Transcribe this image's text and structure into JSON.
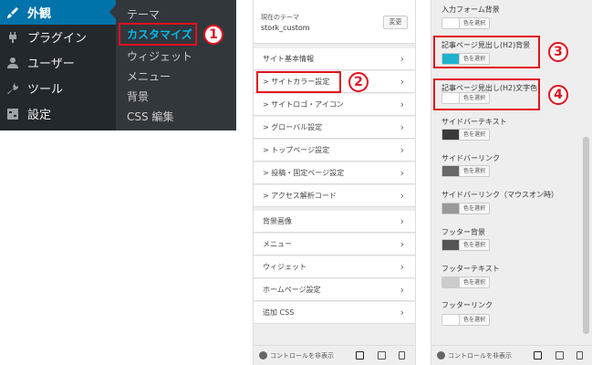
{
  "wp_menu": {
    "items": [
      {
        "label": "外観",
        "icon": "paintbrush-icon",
        "active": true
      },
      {
        "label": "プラグイン",
        "icon": "plug-icon",
        "active": false
      },
      {
        "label": "ユーザー",
        "icon": "user-icon",
        "active": false
      },
      {
        "label": "ツール",
        "icon": "wrench-icon",
        "active": false
      },
      {
        "label": "設定",
        "icon": "settings-icon",
        "active": false
      }
    ],
    "submenu": [
      "テーマ",
      "カスタマイズ",
      "ウィジェット",
      "メニュー",
      "背景",
      "CSS 編集"
    ]
  },
  "annotations": [
    "1",
    "2",
    "3",
    "4"
  ],
  "customizer": {
    "current_theme_label": "現在のテーマ",
    "theme_name": "stork_custom",
    "change_button": "変更",
    "sections": [
      {
        "label": "サイト基本情報"
      },
      {
        "label": "> サイトカラー設定"
      },
      {
        "label": "> サイトロゴ・アイコン"
      },
      {
        "label": "> グローバル設定"
      },
      {
        "label": "> トップページ設定"
      },
      {
        "label": "> 投稿・固定ページ設定"
      },
      {
        "label": "> アクセス解析コード"
      },
      {
        "label": "背景画像"
      },
      {
        "label": "メニュー"
      },
      {
        "label": "ウィジェット"
      },
      {
        "label": "ホームページ設定"
      },
      {
        "label": "追加 CSS"
      }
    ],
    "hide_controls": "コントロールを非表示"
  },
  "colors": {
    "settings": [
      {
        "label": "入力フォーム背景",
        "color": "#ffffff"
      },
      {
        "label": "記事ページ見出し(H2)背景",
        "color": "#1fb2ce"
      },
      {
        "label": "記事ページ見出し(H2)文字色",
        "color": "#ffffff"
      },
      {
        "label": "サイドバーテキスト",
        "color": "#3a3a3a"
      },
      {
        "label": "サイドバーリンク",
        "color": "#676767"
      },
      {
        "label": "サイドバーリンク（マウスオン時）",
        "color": "#999999"
      },
      {
        "label": "フッター背景",
        "color": "#555555"
      },
      {
        "label": "フッターテキスト",
        "color": "#cccccc"
      },
      {
        "label": "フッターリンク",
        "color": "#ffffff"
      }
    ],
    "select_button": "色を選択",
    "hide_controls": "コントロールを非表示"
  }
}
